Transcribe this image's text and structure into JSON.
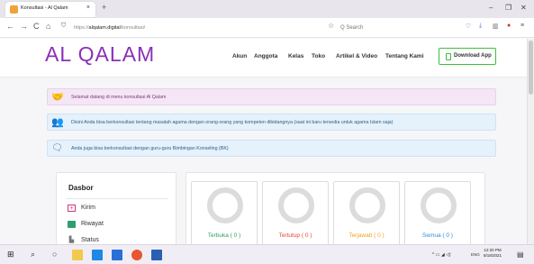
{
  "browser": {
    "tab_title": "Konsultasi - Al Qalam",
    "tab_close": "×",
    "new_tab": "+",
    "win_min": "–",
    "win_max": "❐",
    "win_close": "✕",
    "back": "←",
    "forward": "→",
    "reload": "C",
    "home": "⌂",
    "url_scheme": "https://",
    "url_domain": "alqalam.digital",
    "url_path": "/konsultasi/",
    "star": "☆",
    "search_placeholder": "Q  Search"
  },
  "site": {
    "logo": "AL QALAM",
    "menu": [
      "Akun",
      "Anggota",
      "Kelas",
      "Toko",
      "Artikel & Video",
      "Tentang Kami"
    ],
    "download_label": "Download App"
  },
  "alerts": [
    "Selamat datang di menu konsultasi Al Qalam",
    "Disini Anda bisa berkonsultasi tentang masalah agama dengan orang-orang yang kompeten dibidangnya (saat ini baru tersedia untuk agama Islam saja)",
    "Anda juga bisa berkonsultasi dengan guru-guru Bimbingan Konseling (BK)"
  ],
  "sidebar": {
    "title": "Dasbor",
    "items": [
      {
        "label": "Kirim",
        "icon": "plus-icon",
        "color": "#d2357a"
      },
      {
        "label": "Riwayat",
        "icon": "list-icon",
        "color": "#2e9e6e"
      },
      {
        "label": "Status",
        "icon": "chart-icon",
        "color": "#777777"
      }
    ]
  },
  "stats": [
    {
      "label": "Terbuka ( 0 )",
      "color": "#2f9e5a"
    },
    {
      "label": "Tertutup ( 0 )",
      "color": "#e0453a"
    },
    {
      "label": "Terjawab ( 0 )",
      "color": "#f0a21a"
    },
    {
      "label": "Semua ( 0 )",
      "color": "#2a8fd8"
    }
  ],
  "taskbar": {
    "time": "12:20 PM",
    "date": "8/18/2021",
    "lang": "ENG"
  }
}
